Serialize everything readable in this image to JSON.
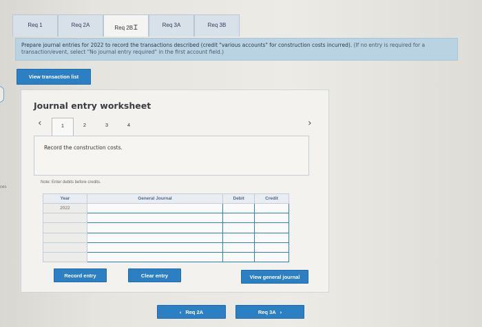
{
  "tabs": [
    {
      "label": "Req 1"
    },
    {
      "label": "Req 2A"
    },
    {
      "label": "Req 2B"
    },
    {
      "label": "Req 3A"
    },
    {
      "label": "Req 3B"
    }
  ],
  "instructions": {
    "main": "Prepare journal entries for 2022 to record the transactions described (credit \"various accounts\" for construction costs incurred).",
    "note": "(If no entry is required for a transaction/event, select \"No journal entry required\" in the first account field.)"
  },
  "view_transaction_list": "View transaction list",
  "side_label": "ces",
  "worksheet": {
    "title": "Journal entry worksheet",
    "prev_icon": "chevron-left-icon",
    "next_icon": "chevron-right-icon",
    "pages": [
      "1",
      "2",
      "3",
      "4"
    ],
    "active_page": "1",
    "description": "Record the construction costs.",
    "note": "Note: Enter debits before credits."
  },
  "journal": {
    "headers": {
      "year": "Year",
      "general_journal": "General Journal",
      "debit": "Debit",
      "credit": "Credit"
    },
    "rows": [
      {
        "year": "2022"
      },
      {
        "year": ""
      },
      {
        "year": ""
      },
      {
        "year": ""
      },
      {
        "year": ""
      },
      {
        "year": ""
      }
    ]
  },
  "buttons": {
    "record_entry": "Record entry",
    "clear_entry": "Clear entry",
    "view_general_journal": "View general journal"
  },
  "nav": {
    "prev_label": "Req 2A",
    "next_label": "Req 3A"
  },
  "colors": {
    "accent": "#2d7fc4",
    "banner": "#b9d3e3"
  }
}
